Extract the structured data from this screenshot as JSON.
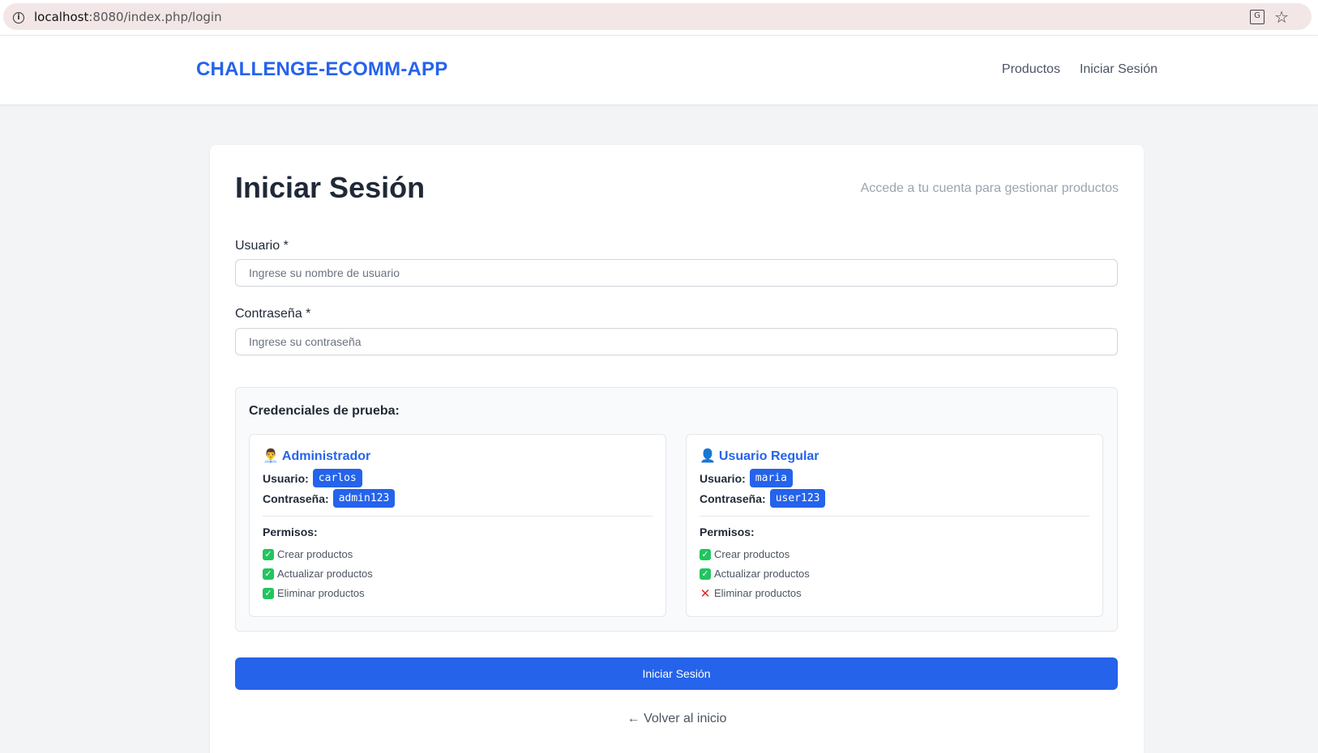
{
  "browser": {
    "url_host": "localhost",
    "url_path": ":8080/index.php/login",
    "info_icon": "info-icon",
    "translate_icon": "translate-icon",
    "star_icon": "star-icon"
  },
  "navbar": {
    "brand": "CHALLENGE-ECOMM-APP",
    "links": [
      {
        "label": "Productos"
      },
      {
        "label": "Iniciar Sesión"
      }
    ]
  },
  "login": {
    "title": "Iniciar Sesión",
    "subtitle": "Accede a tu cuenta para gestionar productos",
    "username_label": "Usuario *",
    "username_placeholder": "Ingrese su nombre de usuario",
    "username_value": "",
    "password_label": "Contraseña *",
    "password_placeholder": "Ingrese su contraseña",
    "password_value": "",
    "submit_label": "Iniciar Sesión",
    "back_label": "← Volver al inicio"
  },
  "credentials": {
    "title": "Credenciales de prueba:",
    "roles": [
      {
        "icon": "👨‍💼",
        "icon_name": "admin-person-icon",
        "name": "Administrador",
        "user_label": "Usuario:",
        "user": "carlos",
        "pass_label": "Contraseña:",
        "pass": "admin123",
        "perms_title": "Permisos:",
        "perms": [
          {
            "label": "Crear productos",
            "allowed": true
          },
          {
            "label": "Actualizar productos",
            "allowed": true
          },
          {
            "label": "Eliminar productos",
            "allowed": true
          }
        ]
      },
      {
        "icon": "👤",
        "icon_name": "user-silhouette-icon",
        "name": "Usuario Regular",
        "user_label": "Usuario:",
        "user": "maria",
        "pass_label": "Contraseña:",
        "pass": "user123",
        "perms_title": "Permisos:",
        "perms": [
          {
            "label": "Crear productos",
            "allowed": true
          },
          {
            "label": "Actualizar productos",
            "allowed": true
          },
          {
            "label": "Eliminar productos",
            "allowed": false
          }
        ]
      }
    ]
  },
  "colors": {
    "accent": "#2563eb",
    "allowed": "#22c55e",
    "denied": "#dc2626"
  }
}
